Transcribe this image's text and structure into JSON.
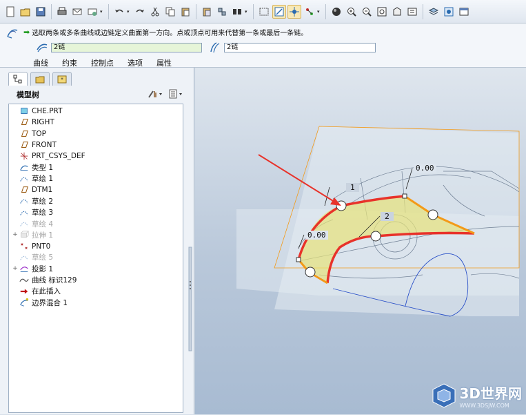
{
  "toolbar": {
    "icons": [
      "new-icon",
      "open-icon",
      "save-icon",
      "print-icon",
      "email-icon",
      "email-link-icon",
      "undo-icon",
      "redo-icon",
      "cut-icon",
      "copy-icon",
      "paste-icon",
      "paste-special-icon",
      "regenerate-icon",
      "find-icon",
      "select-box-icon",
      "repaint-icon",
      "spin-center-icon",
      "orientation-icon",
      "shading-icon",
      "zoom-in-icon",
      "zoom-out-icon",
      "refit-icon",
      "reorient-icon",
      "saved-views-icon",
      "layers-icon",
      "view-manager-icon",
      "window-icon"
    ]
  },
  "dashboard": {
    "message": "选取两条或多条曲线或边链定义曲面第一方向。点或顶点可用来代替第一条或最后一条链。",
    "first_direction_value": "2链",
    "second_direction_value": "2链",
    "tabs": [
      "曲线",
      "约束",
      "控制点",
      "选项",
      "属性"
    ]
  },
  "model_tree": {
    "title": "模型树",
    "items": [
      {
        "label": "CHE.PRT",
        "icon": "part-icon",
        "dim": false,
        "expand": ""
      },
      {
        "label": "RIGHT",
        "icon": "datum-plane-icon",
        "dim": false,
        "expand": ""
      },
      {
        "label": "TOP",
        "icon": "datum-plane-icon",
        "dim": false,
        "expand": ""
      },
      {
        "label": "FRONT",
        "icon": "datum-plane-icon",
        "dim": false,
        "expand": ""
      },
      {
        "label": "PRT_CSYS_DEF",
        "icon": "csys-icon",
        "dim": false,
        "expand": ""
      },
      {
        "label": "类型 1",
        "icon": "style-icon",
        "dim": false,
        "expand": ""
      },
      {
        "label": "草绘 1",
        "icon": "sketch-icon",
        "dim": false,
        "expand": ""
      },
      {
        "label": "DTM1",
        "icon": "datum-plane-icon",
        "dim": false,
        "expand": ""
      },
      {
        "label": "草绘 2",
        "icon": "sketch-icon",
        "dim": false,
        "expand": ""
      },
      {
        "label": "草绘 3",
        "icon": "sketch-icon",
        "dim": false,
        "expand": ""
      },
      {
        "label": "草绘 4",
        "icon": "sketch-icon",
        "dim": true,
        "expand": ""
      },
      {
        "label": "拉伸 1",
        "icon": "extrude-icon",
        "dim": true,
        "expand": "+"
      },
      {
        "label": "PNT0",
        "icon": "datum-point-icon",
        "dim": false,
        "expand": ""
      },
      {
        "label": "草绘 5",
        "icon": "sketch-icon",
        "dim": true,
        "expand": ""
      },
      {
        "label": "投影 1",
        "icon": "projection-icon",
        "dim": false,
        "expand": "+"
      },
      {
        "label": "曲线 标识129",
        "icon": "curve-icon",
        "dim": false,
        "expand": ""
      },
      {
        "label": "在此插入",
        "icon": "insert-here-icon",
        "dim": false,
        "expand": ""
      },
      {
        "label": "边界混合 1",
        "icon": "boundary-blend-icon",
        "dim": false,
        "expand": ""
      }
    ]
  },
  "viewport": {
    "labels": [
      "1",
      "2",
      "0.00",
      "0.00"
    ],
    "watermark": "3D世界网",
    "watermark_sub": "WWW.3DSJW.COM"
  },
  "colors": {
    "accent_green": "#e6f5d8",
    "curve_red": "#e8322a",
    "curve_orange": "#f39a18",
    "surface_yellow": "#e7e27a"
  }
}
